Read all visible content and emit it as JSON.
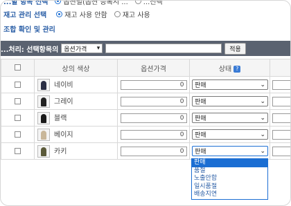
{
  "top_options": {
    "row1_label": "...할 항목 선택",
    "row1_opt1": "옵션별(옵션 등록시 ...",
    "row1_opt2": "...선택"
  },
  "inventory": {
    "label": "재고 관리 선택",
    "options": [
      "재고 사용 안함",
      "재고 사용"
    ],
    "selected": 0
  },
  "combo_link": "조합 확인 및 관리",
  "bulk": {
    "label": "...처리: 선택항목의",
    "field": "옵션가격",
    "apply": "적용"
  },
  "table": {
    "headers": {
      "color": "상의 색상",
      "price": "옵션가격",
      "status": "상태"
    },
    "rows": [
      {
        "color": "네이비",
        "price": "0",
        "status": "판매",
        "swatch": "#2b2f45"
      },
      {
        "color": "그레이",
        "price": "0",
        "status": "판매",
        "swatch": "#222222"
      },
      {
        "color": "블랙",
        "price": "0",
        "status": "판매",
        "swatch": "#1a1a1a"
      },
      {
        "color": "베이지",
        "price": "0",
        "status": "판매",
        "swatch": "#c9b79a"
      },
      {
        "color": "카키",
        "price": "0",
        "status": "판매",
        "swatch": "#5b5a3a"
      }
    ]
  },
  "status_options": [
    "판매",
    "품절",
    "노출안함",
    "일시품절",
    "배송지연"
  ],
  "status_selected": "판매"
}
